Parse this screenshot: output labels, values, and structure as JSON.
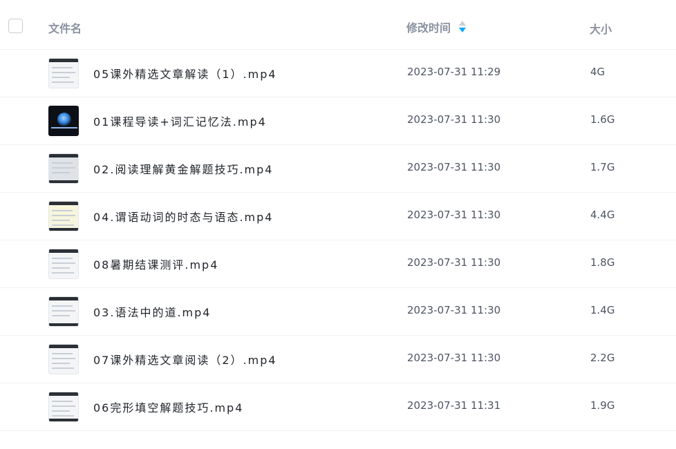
{
  "header": {
    "name_label": "文件名",
    "time_label": "修改时间",
    "size_label": "大小",
    "sort_icon": "sort-descending-icon",
    "sort_active_color": "#06a7ff"
  },
  "files": [
    {
      "name": "05课外精选文章解读（1）.mp4",
      "modified": "2023-07-31 11:29",
      "size": "4G",
      "thumb": "light"
    },
    {
      "name": "01课程导读+词汇记忆法.mp4",
      "modified": "2023-07-31 11:30",
      "size": "1.6G",
      "thumb": "dark"
    },
    {
      "name": "02.阅读理解黄金解题技巧.mp4",
      "modified": "2023-07-31 11:30",
      "size": "1.7G",
      "thumb": "light"
    },
    {
      "name": "04.谓语动词的时态与语态.mp4",
      "modified": "2023-07-31 11:30",
      "size": "4.4G",
      "thumb": "light"
    },
    {
      "name": "08暑期结课测评.mp4",
      "modified": "2023-07-31 11:30",
      "size": "1.8G",
      "thumb": "light"
    },
    {
      "name": "03.语法中的道.mp4",
      "modified": "2023-07-31 11:30",
      "size": "1.4G",
      "thumb": "light"
    },
    {
      "name": "07课外精选文章阅读（2）.mp4",
      "modified": "2023-07-31 11:30",
      "size": "2.2G",
      "thumb": "light"
    },
    {
      "name": "06完形填空解题技巧.mp4",
      "modified": "2023-07-31 11:31",
      "size": "1.9G",
      "thumb": "light"
    }
  ]
}
